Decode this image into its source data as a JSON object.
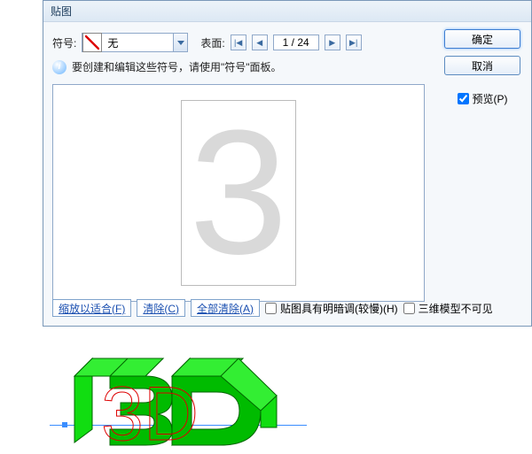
{
  "dialog": {
    "title": "贴图"
  },
  "row1": {
    "symbol_label": "符号:",
    "symbol_value": "无",
    "face_label": "表面:",
    "page": "1 / 24"
  },
  "info": {
    "text": "要创建和编辑这些符号，请使用\"符号\"面板。"
  },
  "buttons": {
    "ok": "确定",
    "cancel": "取消"
  },
  "preview": {
    "checkbox": "预览(P)",
    "glyph": "3"
  },
  "bottom": {
    "fit": "缩放以适合(F)",
    "clear": "清除(C)",
    "clear_all": "全部清除(A)",
    "shade": "贴图具有明暗调(较慢)(H)",
    "hide3d": "三维模型不可见"
  },
  "stage": {
    "text": "3D"
  },
  "icons": {
    "first": "first-icon",
    "prev": "prev-icon",
    "next": "next-icon",
    "last": "last-icon",
    "dropdown": "chevron-down-icon",
    "info": "info-icon"
  }
}
